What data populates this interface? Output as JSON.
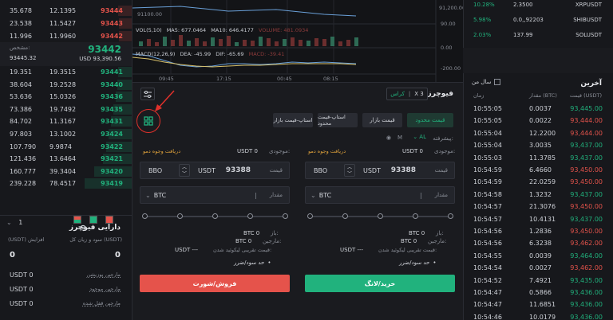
{
  "orderbook": {
    "asks": [
      {
        "c1": "35.678",
        "c2": "12.1395",
        "price": "93444",
        "depth": 0.3
      },
      {
        "c1": "23.538",
        "c2": "11.5427",
        "price": "93443",
        "depth": 0.28
      },
      {
        "c1": "11.996",
        "c2": "11.9960",
        "price": "93442",
        "depth": 0.29
      }
    ],
    "mid": {
      "label": "مشخص:",
      "sub_value": "93445.32",
      "price": "93442",
      "usd_value": "USD 93,390.56"
    },
    "bids": [
      {
        "c1": "19.351",
        "c2": "19.3515",
        "price": "93441",
        "depth": 0.3
      },
      {
        "c1": "38.604",
        "price": "93440",
        "c2": "19.2528",
        "depth": 0.32
      },
      {
        "c1": "53.636",
        "c2": "15.0326",
        "price": "93436",
        "depth": 0.35
      },
      {
        "c1": "73.386",
        "c2": "19.7492",
        "price": "93435",
        "depth": 0.4
      },
      {
        "c1": "84.702",
        "c2": "11.3167",
        "price": "93431",
        "depth": 0.45
      },
      {
        "c1": "97.803",
        "c2": "13.1002",
        "price": "93424",
        "depth": 0.5
      },
      {
        "c1": "107.790",
        "c2": "9.9874",
        "price": "93422",
        "depth": 0.55
      },
      {
        "c1": "121.436",
        "c2": "13.6464",
        "price": "93421",
        "depth": 0.62
      },
      {
        "c1": "160.777",
        "c2": "39.3404",
        "price": "93420",
        "depth": 0.8
      },
      {
        "c1": "239.228",
        "c2": "78.4517",
        "price": "93419",
        "depth": 1.0
      }
    ],
    "precision": "1"
  },
  "assets": {
    "title": "دارایی فیوچرز",
    "col_left": "(USDT) افزایش",
    "col_right": "سود و زیان کل (USDT)",
    "left_value": "0",
    "right_value": "0",
    "rows": [
      {
        "value": "USDT 0",
        "label": "مارجین پوزیشن"
      },
      {
        "value": "USDT 0",
        "label": "مارجین موجود"
      },
      {
        "value": "USDT 0",
        "label": "مارجین قفل شده"
      }
    ]
  },
  "chart": {
    "ma_label": "VOL(5,10)",
    "ma5": "MA5: 677.0464",
    "ma10": "MA10: 646.4177",
    "volume": "VOLUME: 481.0934",
    "macd": "MACD(12,26,9)",
    "dea": "DEA: -45.99",
    "dif": "DIF: -65.69",
    "macd_val": "MACD: -39.41",
    "price_ticks": [
      "91100.00",
      "91,200.00"
    ],
    "right_ticks": [
      "90.00",
      "0.00",
      "-200.00"
    ],
    "time_ticks": [
      "09:45",
      "17:15",
      "00:45",
      "08:15"
    ]
  },
  "trade": {
    "title": "فیوچرز",
    "cross": "کراس",
    "leverage": "X 3",
    "tabs": [
      "قیمت محدود",
      "قیمت بازار",
      "استاپ-قیمت محدود",
      "استاپ-قیمت بازار"
    ],
    "advanced_label": "پیشرفته:",
    "al": "AL",
    "m": "M",
    "buy": {
      "available_label": "موجودی:",
      "available_value": "USDT 0",
      "deposit_link": "دریافت وجوه دمو",
      "price_label": "قیمت",
      "price_value": "93388",
      "price_unit": "USDT",
      "bbo": "BBO",
      "amount_label": "مقدار",
      "amount_unit": "BTC",
      "max_label": "باز:",
      "max_value": "BTC 0",
      "margin_label": "مارجین:",
      "margin_value": "BTC 0",
      "liq_label": "قیمت تقریبی لیکوئید شدن:",
      "liq_value": "USDT ---",
      "tpsl": "حد سود/ضرر",
      "button": "خرید/لانگ"
    },
    "sell": {
      "available_label": "موجودی:",
      "available_value": "USDT 0",
      "deposit_link": "دریافت وجوه دمو",
      "price_label": "قیمت",
      "price_value": "93388",
      "price_unit": "USDT",
      "bbo": "BBO",
      "amount_label": "مقدار",
      "amount_unit": "BTC",
      "max_label": "باز:",
      "max_value": "BTC 0",
      "margin_label": "مارجین:",
      "margin_value": "BTC 0",
      "liq_label": "قیمت تقریبی لیکوئید شدن:",
      "liq_value": "USDT ---",
      "tpsl": "حد سود/ضرر",
      "button": "فروش/شورت"
    }
  },
  "ticker": [
    {
      "change": "10.28%",
      "price": "2.3500",
      "symbol": "XRPUSDT"
    },
    {
      "change": "5.98%",
      "price": "0.0,,92203",
      "symbol": "SHIBUSDT"
    },
    {
      "change": "2.03%",
      "price": "137.99",
      "symbol": "SOLUSDT"
    }
  ],
  "trades": {
    "title": "آخرین",
    "filter_label": "سال من",
    "col_time": "زمان",
    "col_amount": "مقدار (BTC)",
    "col_price": "قیمت (USDT)",
    "rows": [
      {
        "time": "10:55:05",
        "amount": "0.0037",
        "price": "93,445.00",
        "side": "buy"
      },
      {
        "time": "10:55:05",
        "amount": "0.0022",
        "price": "93,444.00",
        "side": "sell"
      },
      {
        "time": "10:55:04",
        "amount": "12.2200",
        "price": "93,444.00",
        "side": "sell"
      },
      {
        "time": "10:55:04",
        "amount": "3.0035",
        "price": "93,437.00",
        "side": "buy"
      },
      {
        "time": "10:55:03",
        "amount": "11.3785",
        "price": "93,437.00",
        "side": "buy"
      },
      {
        "time": "10:54:59",
        "amount": "6.4660",
        "price": "93,450.00",
        "side": "sell"
      },
      {
        "time": "10:54:59",
        "amount": "22.0259",
        "price": "93,450.00",
        "side": "sell"
      },
      {
        "time": "10:54:58",
        "amount": "1.3232",
        "price": "93,437.00",
        "side": "buy"
      },
      {
        "time": "10:54:57",
        "amount": "21.3076",
        "price": "93,450.00",
        "side": "sell"
      },
      {
        "time": "10:54:57",
        "amount": "10.4131",
        "price": "93,437.00",
        "side": "buy"
      },
      {
        "time": "10:54:56",
        "amount": "1.2836",
        "price": "93,450.00",
        "side": "sell"
      },
      {
        "time": "10:54:56",
        "amount": "6.3238",
        "price": "93,462.00",
        "side": "sell"
      },
      {
        "time": "10:54:55",
        "amount": "0.0039",
        "price": "93,464.00",
        "side": "buy"
      },
      {
        "time": "10:54:54",
        "amount": "0.0027",
        "price": "93,462.00",
        "side": "sell"
      },
      {
        "time": "10:54:52",
        "amount": "7.4921",
        "price": "93,435.00",
        "side": "buy"
      },
      {
        "time": "10:54:47",
        "amount": "0.5866",
        "price": "93,436.00",
        "side": "buy"
      },
      {
        "time": "10:54:47",
        "amount": "11.6851",
        "price": "93,436.00",
        "side": "buy"
      },
      {
        "time": "10:54:46",
        "amount": "10.0179",
        "price": "93,436.00",
        "side": "buy"
      }
    ]
  },
  "colors": {
    "buy": "#21b27d",
    "sell": "#e5534b",
    "annotation": "#e0312b"
  }
}
